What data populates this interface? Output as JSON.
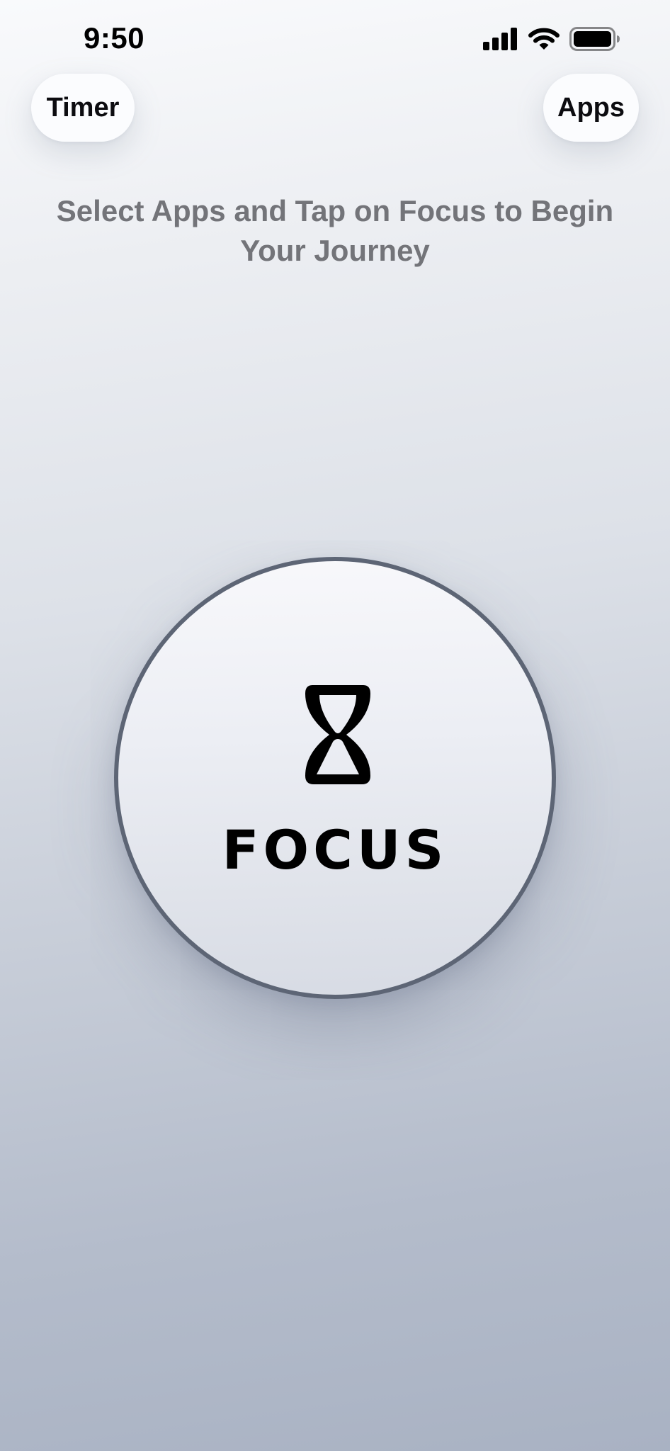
{
  "status_bar": {
    "time": "9:50",
    "icons": [
      "cellular-signal-icon",
      "wifi-icon",
      "battery-icon"
    ]
  },
  "header": {
    "timer_label": "Timer",
    "apps_label": "Apps"
  },
  "main": {
    "instruction": "Select Apps and Tap on Focus to Begin Your Journey",
    "focus_button": {
      "label": "FOCUS",
      "icon": "hourglass-icon"
    }
  },
  "colors": {
    "ring": "#5d6575",
    "instruction_text": "#737479",
    "pill_background": "#fbfcfe"
  }
}
